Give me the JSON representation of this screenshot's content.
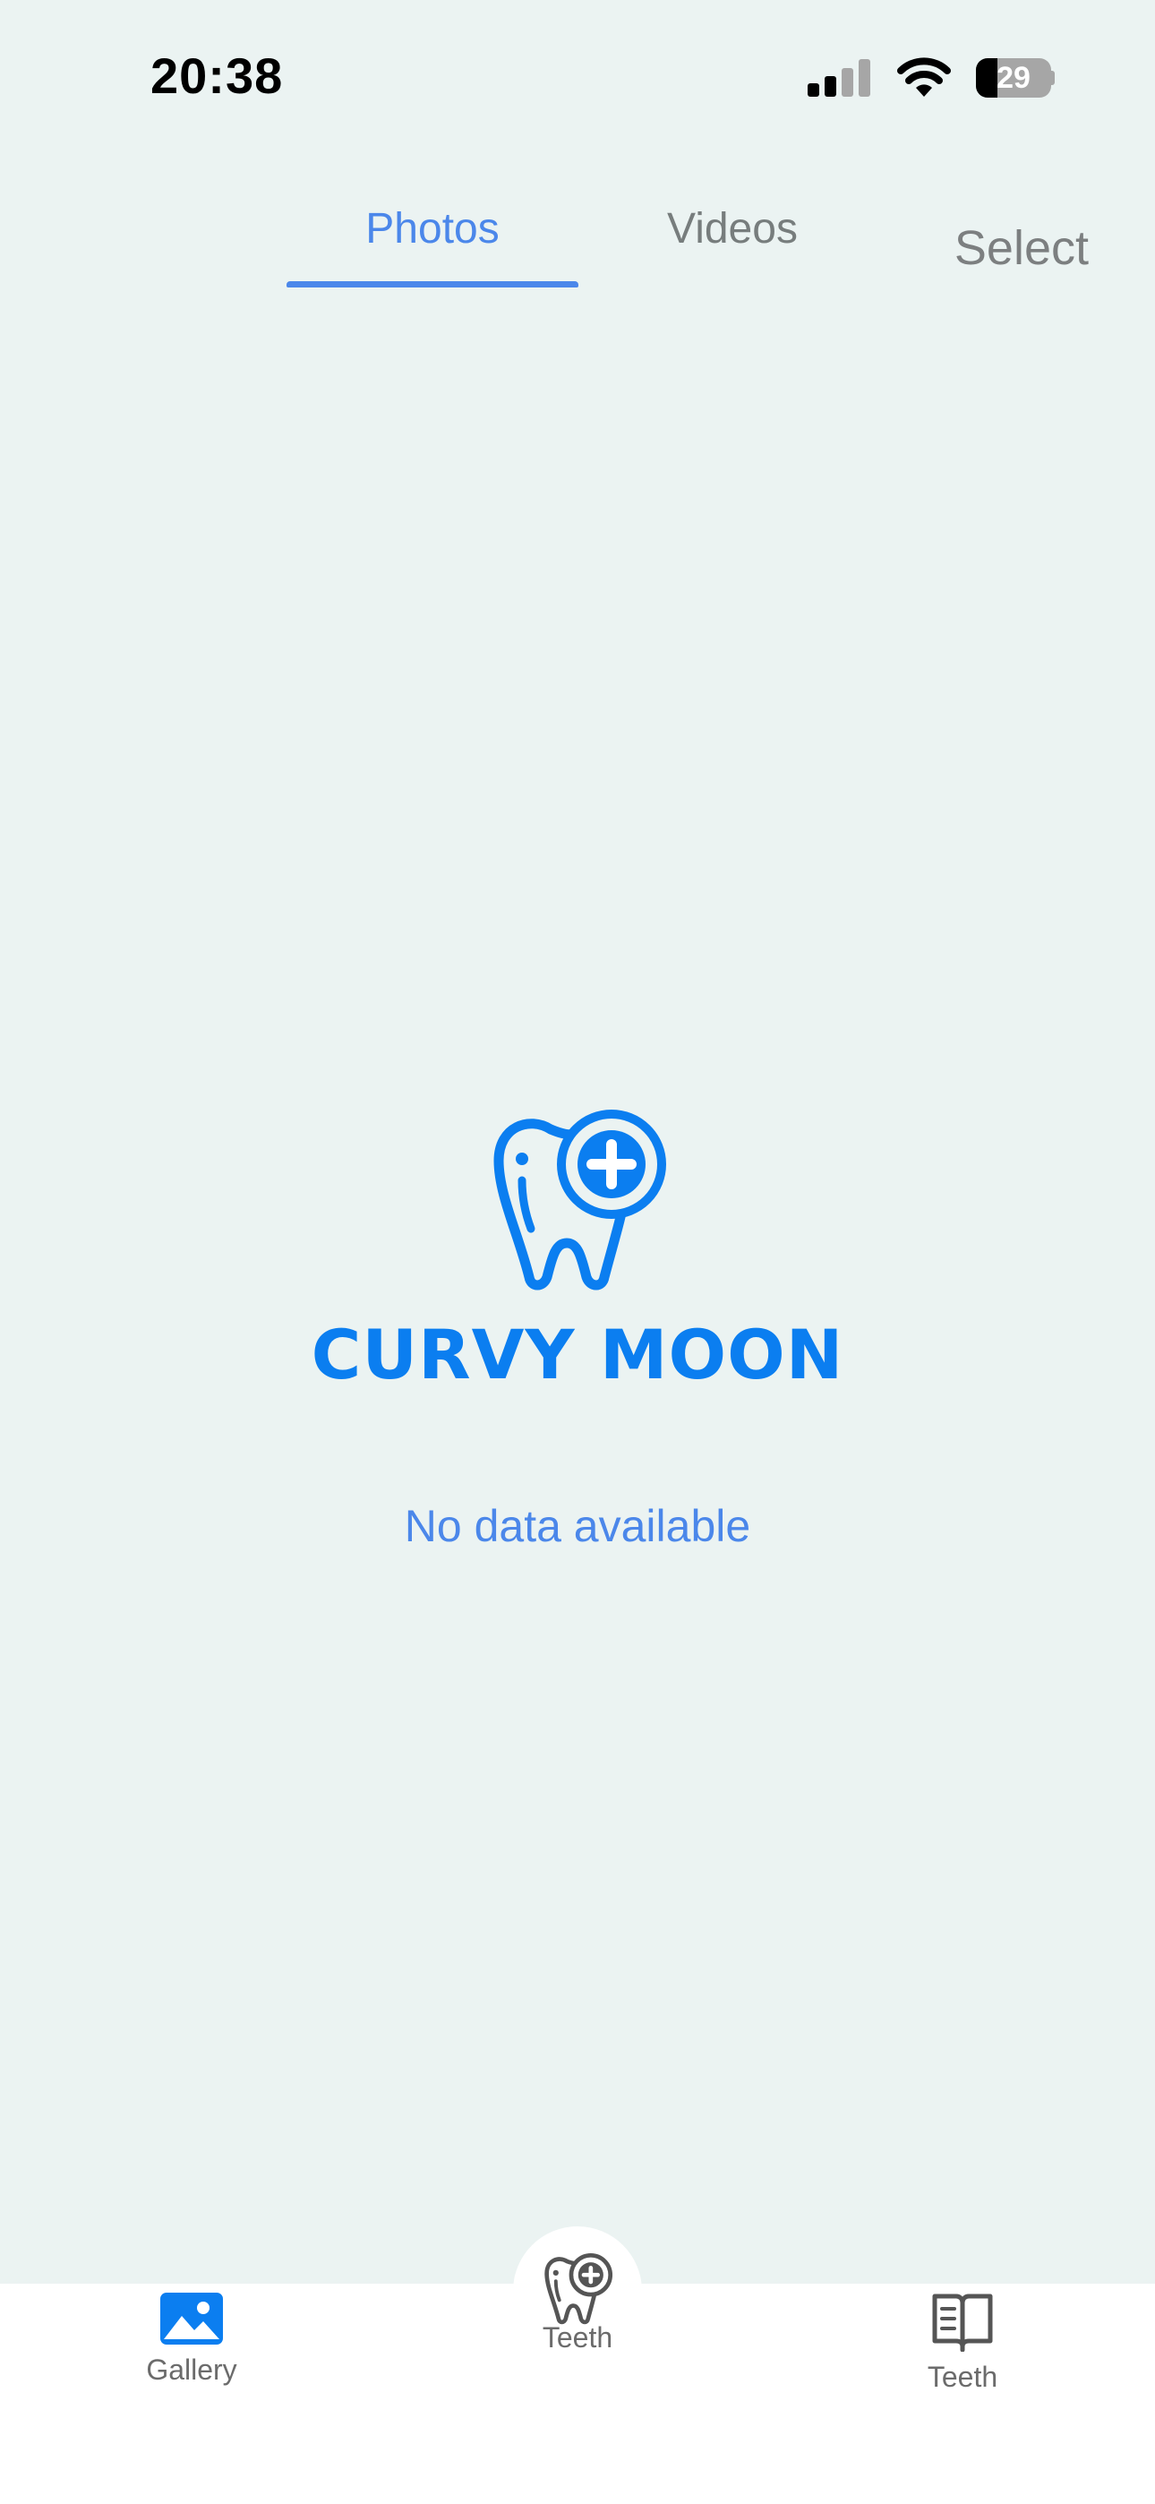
{
  "status_bar": {
    "time": "20:38",
    "battery_level": "29",
    "battery_fraction": 0.29
  },
  "tabs": [
    {
      "label": "Photos",
      "active": true
    },
    {
      "label": "Videos",
      "active": false
    }
  ],
  "select_label": "Select",
  "empty_state": {
    "brand": "CURVY MOON",
    "message": "No data available"
  },
  "bottom_nav": {
    "items": [
      {
        "label": "Gallery",
        "icon": "gallery-icon"
      },
      {
        "label": "Teeth",
        "icon": "tooth-plus-icon"
      },
      {
        "label": "Teeth",
        "icon": "book-icon"
      }
    ]
  },
  "colors": {
    "accent": "#4b87ea",
    "brand": "#0b7ef0",
    "background": "#ebf3f2"
  }
}
